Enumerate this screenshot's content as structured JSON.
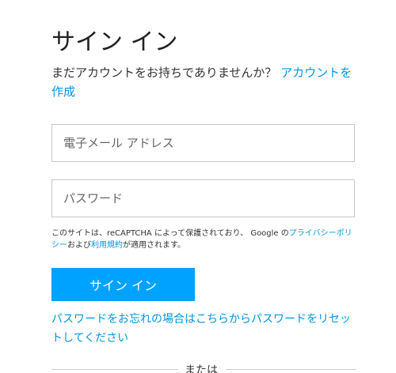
{
  "title": "サイン イン",
  "signup": {
    "prompt": "まだアカウントをお持ちでありませんか？",
    "link_label": "アカウントを作成"
  },
  "email": {
    "placeholder": "電子メール アドレス"
  },
  "password": {
    "placeholder": "パスワード"
  },
  "recaptcha": {
    "text_before": "このサイトは、reCAPTCHA によって保護されており、 Google の",
    "privacy_label": "プライバシーポリシー",
    "text_middle": "および",
    "terms_label": "利用規約",
    "text_after": "が適用されます。"
  },
  "signin_button": "サイン イン",
  "reset_link": "パスワードをお忘れの場合はこちらからパスワードをリセットしてください",
  "divider_text": "または",
  "colors": {
    "accent": "#00a2ff",
    "link": "#0096e0"
  }
}
